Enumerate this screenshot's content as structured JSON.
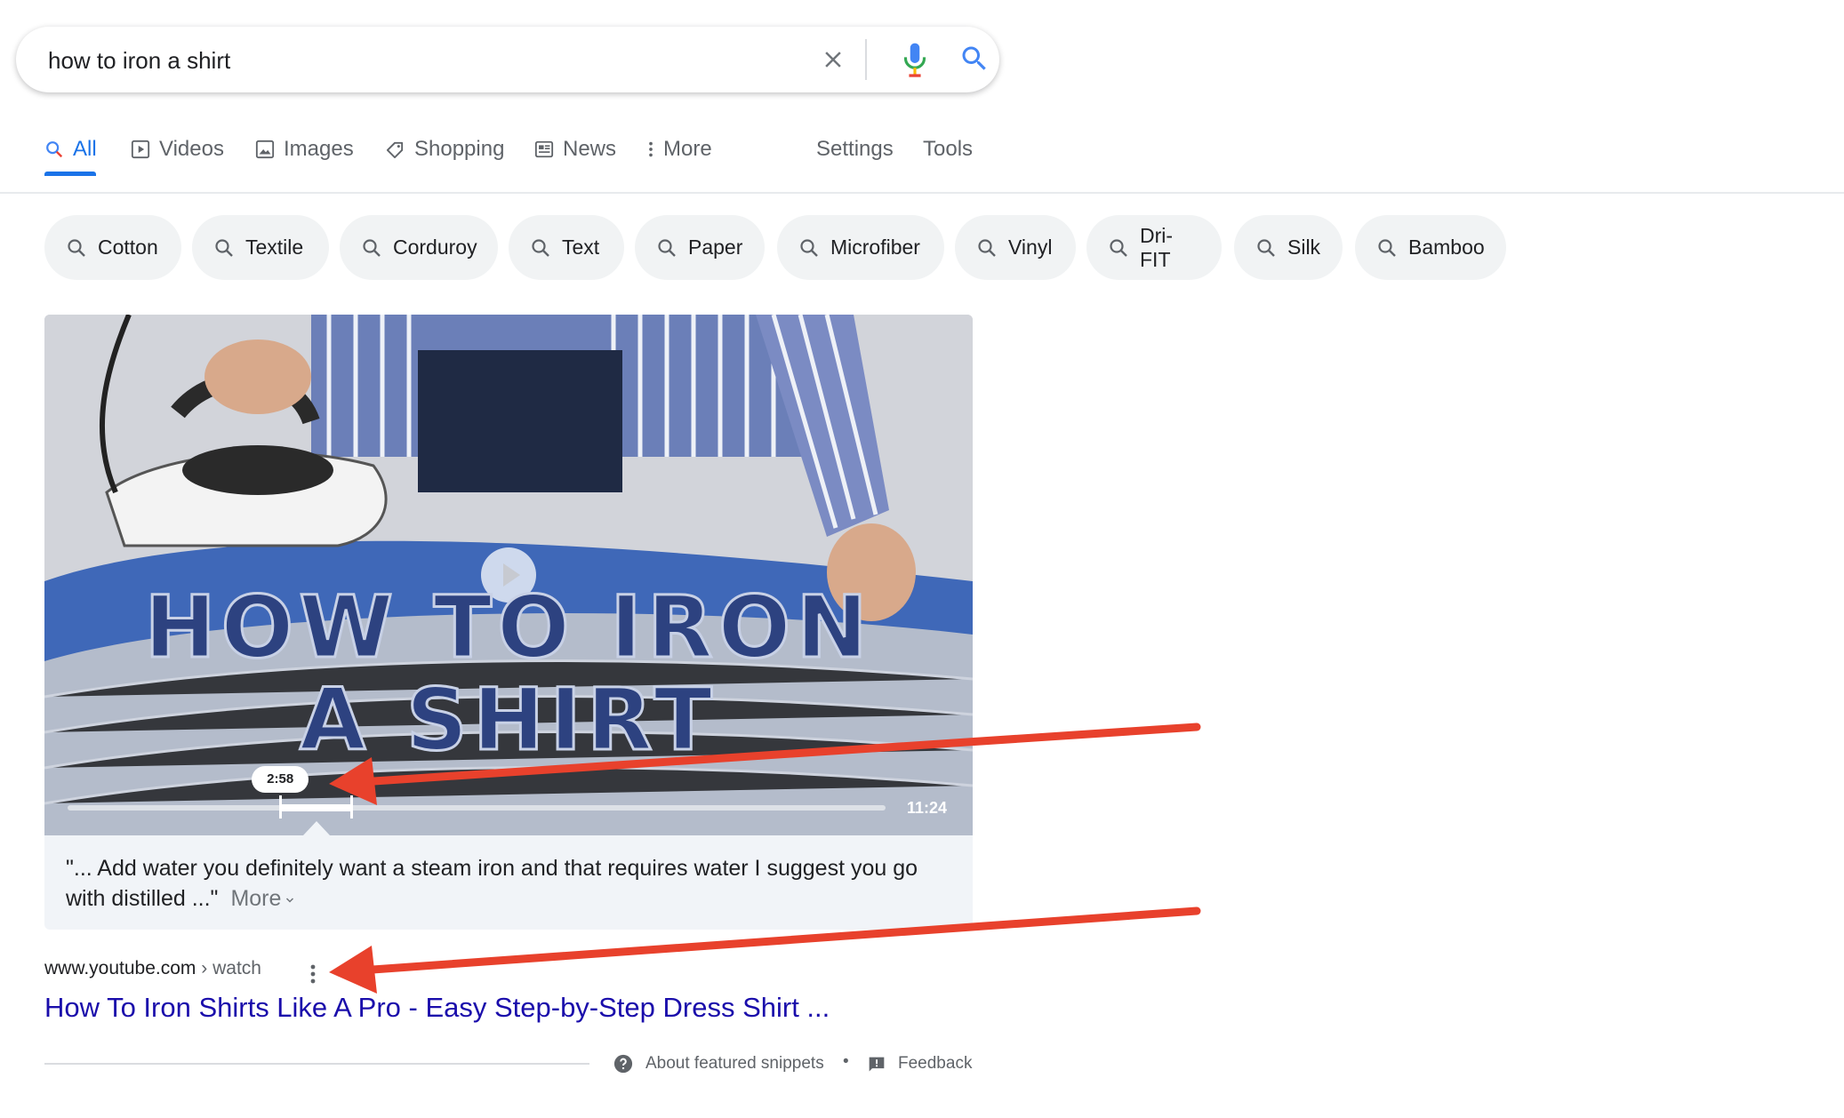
{
  "search": {
    "query": "how to iron a shirt"
  },
  "tabs": [
    {
      "label": "All"
    },
    {
      "label": "Videos"
    },
    {
      "label": "Images"
    },
    {
      "label": "Shopping"
    },
    {
      "label": "News"
    },
    {
      "label": "More"
    }
  ],
  "tools": {
    "settings": "Settings",
    "tools": "Tools"
  },
  "chips": [
    "Cotton",
    "Textile",
    "Corduroy",
    "Text",
    "Paper",
    "Microfiber",
    "Vinyl",
    "Dri-FIT",
    "Silk",
    "Bamboo"
  ],
  "video": {
    "title_line1": "HOW TO IRON",
    "title_line2": "A SHIRT",
    "key_moment_time": "2:58",
    "duration": "11:24",
    "key_moment_progress": 0.26,
    "key_moment_end_progress": 0.347
  },
  "snippet": {
    "text": "\"... Add water you definitely want a steam iron and that requires water I suggest you go with distilled ...\"",
    "more": "More"
  },
  "result": {
    "domain": "www.youtube.com",
    "breadcrumb": "› watch",
    "title": "How To Iron Shirts Like A Pro - Easy Step-by-Step Dress Shirt ..."
  },
  "footer": {
    "about": "About featured snippets",
    "separator": "•",
    "feedback": "Feedback"
  },
  "colors": {
    "link": "#1a0dab",
    "accent": "#1a73e8",
    "annotation": "#e8412c"
  }
}
